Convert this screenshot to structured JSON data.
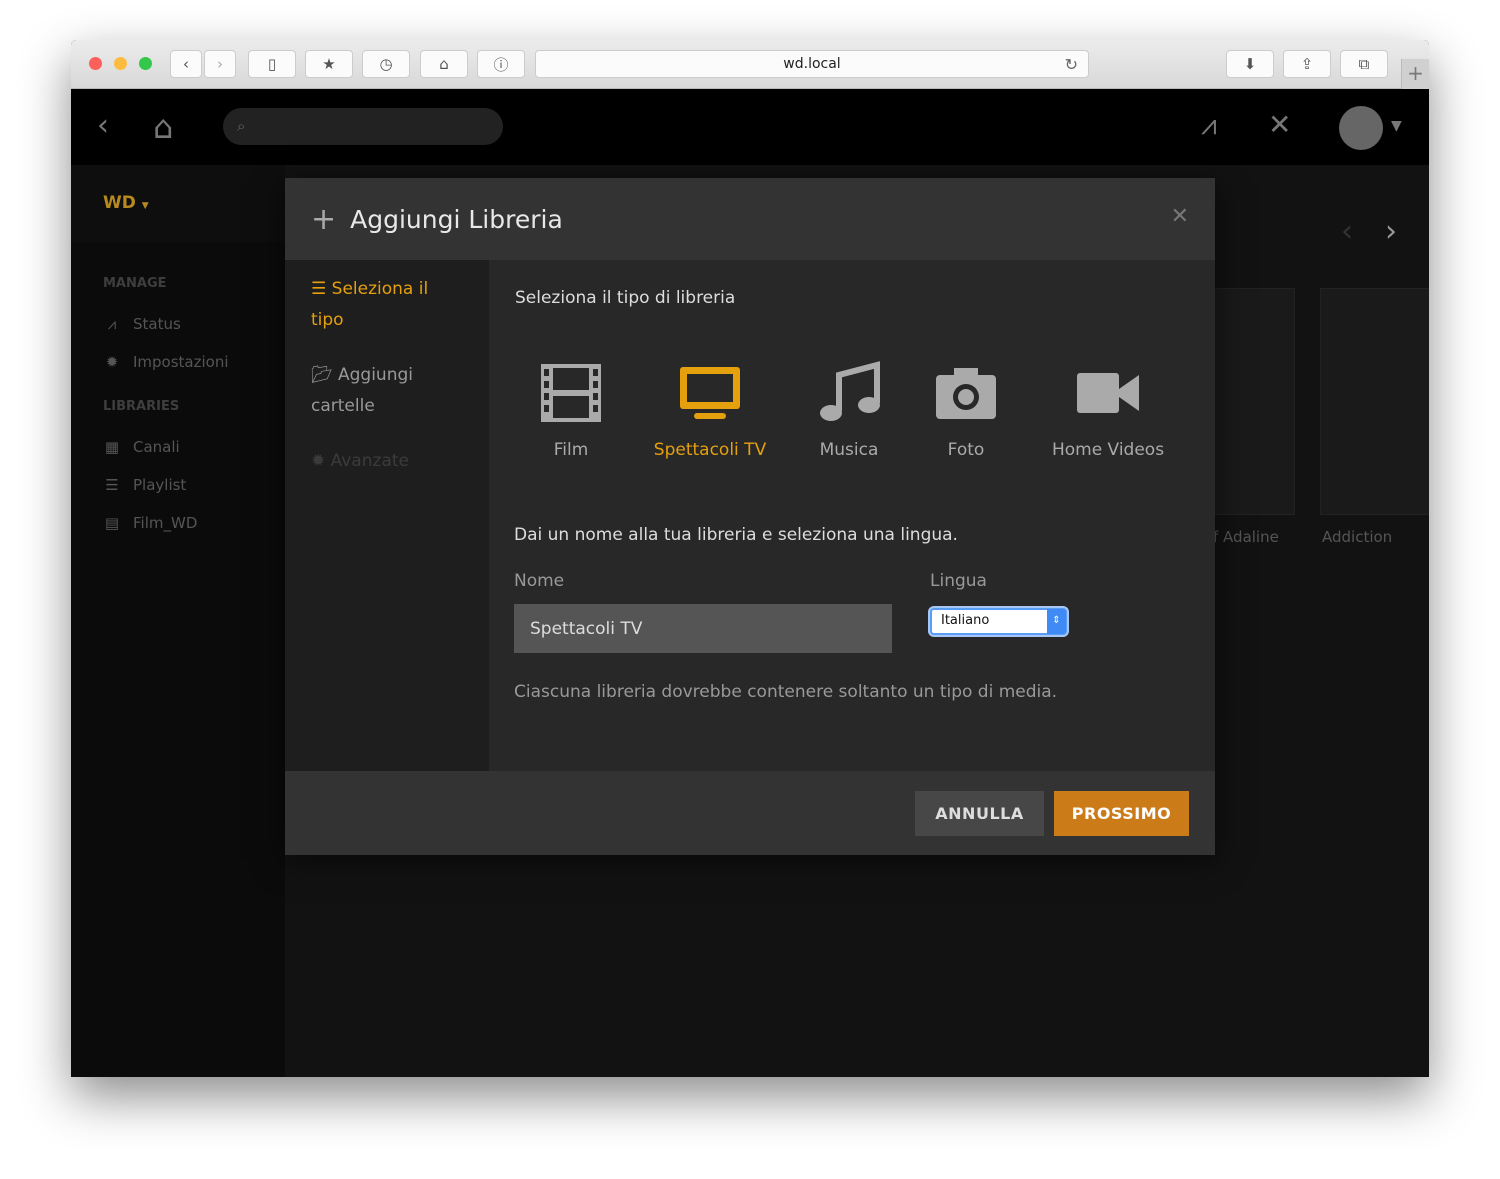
{
  "browser": {
    "url": "wd.local"
  },
  "sidebar": {
    "server": "WD",
    "manage_heading": "MANAGE",
    "libraries_heading": "LIBRARIES",
    "manage_items": [
      {
        "label": "Status"
      },
      {
        "label": "Impostazioni"
      }
    ],
    "library_items": [
      {
        "label": "Canali"
      },
      {
        "label": "Playlist"
      },
      {
        "label": "Film_WD"
      }
    ]
  },
  "background": {
    "posters": [
      {
        "title": "f Adaline"
      },
      {
        "title": "Addiction"
      }
    ]
  },
  "dialog": {
    "title": "Aggiungi Libreria",
    "steps": [
      {
        "label": "Seleziona il tipo",
        "state": "active"
      },
      {
        "label": "Aggiungi cartelle",
        "state": "normal"
      },
      {
        "label": "Avanzate",
        "state": "disabled"
      }
    ],
    "type_prompt": "Seleziona il tipo di libreria",
    "types": [
      {
        "label": "Film",
        "icon": "film-icon"
      },
      {
        "label": "Spettacoli TV",
        "icon": "tv-icon",
        "selected": true
      },
      {
        "label": "Musica",
        "icon": "music-icon"
      },
      {
        "label": "Foto",
        "icon": "camera-icon"
      },
      {
        "label": "Home Videos",
        "icon": "video-camera-icon"
      }
    ],
    "name_prompt": "Dai un nome alla tua libreria e seleziona una lingua.",
    "name_label": "Nome",
    "name_value": "Spettacoli TV",
    "language_label": "Lingua",
    "language_value": "Italiano",
    "hint": "Ciascuna libreria dovrebbe contenere soltanto un tipo di media.",
    "cancel_label": "ANNULLA",
    "next_label": "PROSSIMO"
  },
  "colors": {
    "accent": "#e5a00d",
    "primary_button": "#cc7b19"
  }
}
